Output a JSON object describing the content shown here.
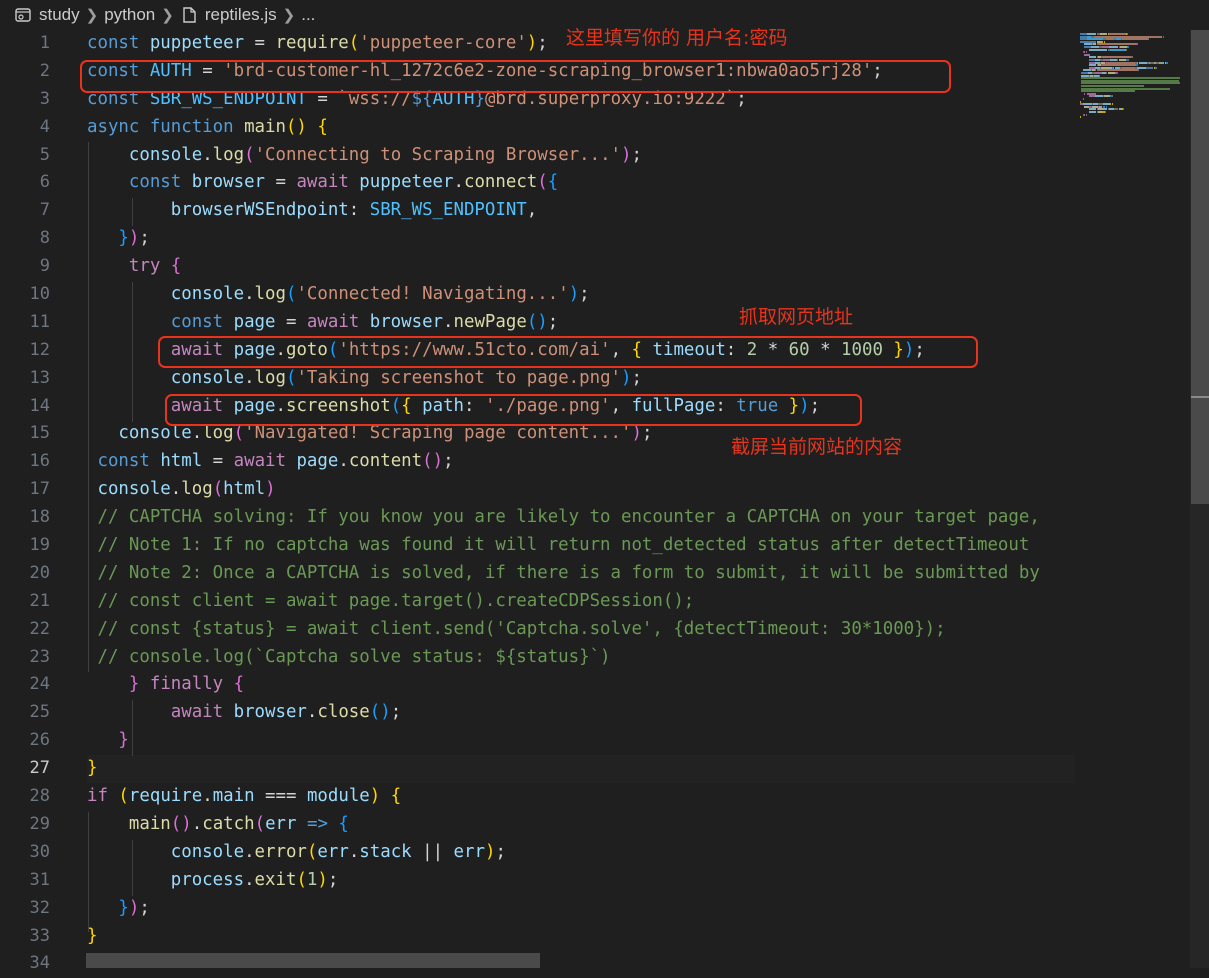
{
  "breadcrumb": {
    "items": [
      "study",
      "python",
      "reptiles.js",
      "..."
    ],
    "icons": [
      "folder-settings-icon",
      "chevron-right-icon",
      "file-icon"
    ]
  },
  "editor": {
    "active_line": 27,
    "line_numbers": [
      "1",
      "2",
      "3",
      "4",
      "5",
      "6",
      "7",
      "8",
      "9",
      "10",
      "11",
      "12",
      "13",
      "14",
      "15",
      "16",
      "17",
      "18",
      "19",
      "20",
      "21",
      "22",
      "23",
      "24",
      "25",
      "26",
      "27",
      "28",
      "29",
      "30",
      "31",
      "32",
      "33",
      "34"
    ],
    "lines": [
      [
        [
          "kw",
          "const "
        ],
        [
          "var",
          "puppeteer"
        ],
        [
          "op",
          " = "
        ],
        [
          "fn",
          "require"
        ],
        [
          "p1",
          "("
        ],
        [
          "str",
          "'puppeteer-core'"
        ],
        [
          "p1",
          ")"
        ],
        [
          "op",
          ";"
        ]
      ],
      [
        [
          "kw",
          "const "
        ],
        [
          "cst",
          "AUTH"
        ],
        [
          "op",
          " = "
        ],
        [
          "str",
          "'brd-customer-hl_1272c6e2-zone-scraping_browser1:nbwa0ao5rj28'"
        ],
        [
          "op",
          ";"
        ]
      ],
      [
        [
          "kw",
          "const "
        ],
        [
          "cst",
          "SBR_WS_ENDPOINT"
        ],
        [
          "op",
          " = "
        ],
        [
          "str",
          "`wss://"
        ],
        [
          "kw",
          "${"
        ],
        [
          "cst",
          "AUTH"
        ],
        [
          "kw",
          "}"
        ],
        [
          "str",
          "@brd.superproxy.io:9222`"
        ],
        [
          "op",
          ";"
        ]
      ],
      [
        [
          "kw",
          "async "
        ],
        [
          "kw",
          "function "
        ],
        [
          "fn",
          "main"
        ],
        [
          "p1",
          "()"
        ],
        [
          "op",
          " "
        ],
        [
          "p1",
          "{"
        ]
      ],
      [
        [
          "op",
          "    "
        ],
        [
          "var",
          "console"
        ],
        [
          "op",
          "."
        ],
        [
          "fn",
          "log"
        ],
        [
          "p2",
          "("
        ],
        [
          "str",
          "'Connecting to Scraping Browser...'"
        ],
        [
          "p2",
          ")"
        ],
        [
          "op",
          ";"
        ]
      ],
      [
        [
          "op",
          "    "
        ],
        [
          "kw",
          "const "
        ],
        [
          "var",
          "browser"
        ],
        [
          "op",
          " = "
        ],
        [
          "kw2",
          "await "
        ],
        [
          "var",
          "puppeteer"
        ],
        [
          "op",
          "."
        ],
        [
          "fn",
          "connect"
        ],
        [
          "p2",
          "("
        ],
        [
          "p3",
          "{"
        ]
      ],
      [
        [
          "op",
          "        "
        ],
        [
          "var",
          "browserWSEndpoint"
        ],
        [
          "op",
          ": "
        ],
        [
          "cst",
          "SBR_WS_ENDPOINT"
        ],
        [
          "op",
          ","
        ]
      ],
      [
        [
          "op",
          "   "
        ],
        [
          "p3",
          "}"
        ],
        [
          "p2",
          ")"
        ],
        [
          "op",
          ";"
        ]
      ],
      [
        [
          "op",
          "    "
        ],
        [
          "kw2",
          "try "
        ],
        [
          "p2",
          "{"
        ]
      ],
      [
        [
          "op",
          "        "
        ],
        [
          "var",
          "console"
        ],
        [
          "op",
          "."
        ],
        [
          "fn",
          "log"
        ],
        [
          "p3",
          "("
        ],
        [
          "str",
          "'Connected! Navigating...'"
        ],
        [
          "p3",
          ")"
        ],
        [
          "op",
          ";"
        ]
      ],
      [
        [
          "op",
          "        "
        ],
        [
          "kw",
          "const "
        ],
        [
          "var",
          "page"
        ],
        [
          "op",
          " = "
        ],
        [
          "kw2",
          "await "
        ],
        [
          "var",
          "browser"
        ],
        [
          "op",
          "."
        ],
        [
          "fn",
          "newPage"
        ],
        [
          "p3",
          "()"
        ],
        [
          "op",
          ";"
        ]
      ],
      [
        [
          "op",
          "        "
        ],
        [
          "kw2",
          "await "
        ],
        [
          "var",
          "page"
        ],
        [
          "op",
          "."
        ],
        [
          "fn",
          "goto"
        ],
        [
          "p3",
          "("
        ],
        [
          "str",
          "'https://www.51cto.com/ai'"
        ],
        [
          "op",
          ", "
        ],
        [
          "p1",
          "{"
        ],
        [
          "op",
          " "
        ],
        [
          "var",
          "timeout"
        ],
        [
          "op",
          ": "
        ],
        [
          "num",
          "2"
        ],
        [
          "op",
          " * "
        ],
        [
          "num",
          "60"
        ],
        [
          "op",
          " * "
        ],
        [
          "num",
          "1000"
        ],
        [
          "op",
          " "
        ],
        [
          "p1",
          "}"
        ],
        [
          "p3",
          ")"
        ],
        [
          "op",
          ";"
        ]
      ],
      [
        [
          "op",
          "        "
        ],
        [
          "var",
          "console"
        ],
        [
          "op",
          "."
        ],
        [
          "fn",
          "log"
        ],
        [
          "p3",
          "("
        ],
        [
          "str",
          "'Taking screenshot to page.png'"
        ],
        [
          "p3",
          ")"
        ],
        [
          "op",
          ";"
        ]
      ],
      [
        [
          "op",
          "        "
        ],
        [
          "kw2",
          "await "
        ],
        [
          "var",
          "page"
        ],
        [
          "op",
          "."
        ],
        [
          "fn",
          "screenshot"
        ],
        [
          "p3",
          "("
        ],
        [
          "p1",
          "{"
        ],
        [
          "op",
          " "
        ],
        [
          "var",
          "path"
        ],
        [
          "op",
          ": "
        ],
        [
          "str",
          "'./page.png'"
        ],
        [
          "op",
          ", "
        ],
        [
          "var",
          "fullPage"
        ],
        [
          "op",
          ": "
        ],
        [
          "kw",
          "true"
        ],
        [
          "op",
          " "
        ],
        [
          "p1",
          "}"
        ],
        [
          "p3",
          ")"
        ],
        [
          "op",
          ";"
        ]
      ],
      [
        [
          "op",
          "   "
        ],
        [
          "var",
          "console"
        ],
        [
          "op",
          "."
        ],
        [
          "fn",
          "log"
        ],
        [
          "p2",
          "("
        ],
        [
          "str",
          "'Navigated! Scraping page content...'"
        ],
        [
          "p2",
          ")"
        ],
        [
          "op",
          ";"
        ]
      ],
      [
        [
          "op",
          " "
        ],
        [
          "kw",
          "const "
        ],
        [
          "var",
          "html"
        ],
        [
          "op",
          " = "
        ],
        [
          "kw2",
          "await "
        ],
        [
          "var",
          "page"
        ],
        [
          "op",
          "."
        ],
        [
          "fn",
          "content"
        ],
        [
          "p2",
          "()"
        ],
        [
          "op",
          ";"
        ]
      ],
      [
        [
          "op",
          " "
        ],
        [
          "var",
          "console"
        ],
        [
          "op",
          "."
        ],
        [
          "fn",
          "log"
        ],
        [
          "p2",
          "("
        ],
        [
          "var",
          "html"
        ],
        [
          "p2",
          ")"
        ]
      ],
      [
        [
          "op",
          " "
        ],
        [
          "cmt",
          "// CAPTCHA solving: If you know you are likely to encounter a CAPTCHA on your target page,"
        ]
      ],
      [
        [
          "op",
          " "
        ],
        [
          "cmt",
          "// Note 1: If no captcha was found it will return not_detected status after detectTimeout"
        ]
      ],
      [
        [
          "op",
          " "
        ],
        [
          "cmt",
          "// Note 2: Once a CAPTCHA is solved, if there is a form to submit, it will be submitted by"
        ]
      ],
      [
        [
          "op",
          " "
        ],
        [
          "cmt",
          "// const client = await page.target().createCDPSession();"
        ]
      ],
      [
        [
          "op",
          " "
        ],
        [
          "cmt",
          "// const {status} = await client.send('Captcha.solve', {detectTimeout: 30*1000});"
        ]
      ],
      [
        [
          "op",
          " "
        ],
        [
          "cmt",
          "// console.log(`Captcha solve status: ${status}`)"
        ]
      ],
      [
        [
          "op",
          "    "
        ],
        [
          "p2",
          "}"
        ],
        [
          "op",
          " "
        ],
        [
          "kw2",
          "finally "
        ],
        [
          "p2",
          "{"
        ]
      ],
      [
        [
          "op",
          "        "
        ],
        [
          "kw2",
          "await "
        ],
        [
          "var",
          "browser"
        ],
        [
          "op",
          "."
        ],
        [
          "fn",
          "close"
        ],
        [
          "p3",
          "()"
        ],
        [
          "op",
          ";"
        ]
      ],
      [
        [
          "op",
          "   "
        ],
        [
          "p2",
          "}"
        ]
      ],
      [
        [
          "p1",
          "}"
        ]
      ],
      [
        [
          "kw2",
          "if "
        ],
        [
          "p1",
          "("
        ],
        [
          "var",
          "require"
        ],
        [
          "op",
          "."
        ],
        [
          "var",
          "main"
        ],
        [
          "op",
          " === "
        ],
        [
          "var",
          "module"
        ],
        [
          "p1",
          ")"
        ],
        [
          "op",
          " "
        ],
        [
          "p1",
          "{"
        ]
      ],
      [
        [
          "op",
          "    "
        ],
        [
          "fn",
          "main"
        ],
        [
          "p2",
          "()"
        ],
        [
          "op",
          "."
        ],
        [
          "fn",
          "catch"
        ],
        [
          "p2",
          "("
        ],
        [
          "var",
          "err"
        ],
        [
          "op",
          " "
        ],
        [
          "kw",
          "=>"
        ],
        [
          "op",
          " "
        ],
        [
          "p3",
          "{"
        ]
      ],
      [
        [
          "op",
          "        "
        ],
        [
          "var",
          "console"
        ],
        [
          "op",
          "."
        ],
        [
          "fn",
          "error"
        ],
        [
          "p1",
          "("
        ],
        [
          "var",
          "err"
        ],
        [
          "op",
          "."
        ],
        [
          "var",
          "stack"
        ],
        [
          "op",
          " || "
        ],
        [
          "var",
          "err"
        ],
        [
          "p1",
          ")"
        ],
        [
          "op",
          ";"
        ]
      ],
      [
        [
          "op",
          "        "
        ],
        [
          "var",
          "process"
        ],
        [
          "op",
          "."
        ],
        [
          "fn",
          "exit"
        ],
        [
          "p1",
          "("
        ],
        [
          "num",
          "1"
        ],
        [
          "p1",
          ")"
        ],
        [
          "op",
          ";"
        ]
      ],
      [
        [
          "op",
          "   "
        ],
        [
          "p3",
          "}"
        ],
        [
          "p2",
          ")"
        ],
        [
          "op",
          ";"
        ]
      ],
      [
        [
          "p1",
          "}"
        ]
      ],
      [
        [
          "op",
          ""
        ]
      ]
    ]
  },
  "annotations": {
    "auth": "这里填写你的 用户名:密码",
    "url": "抓取网页地址",
    "screenshot": "截屏当前网站的内容"
  },
  "colors": {
    "background": "#1f1f1f",
    "highlight": "#e8341c",
    "keyword": "#569cd6",
    "control": "#c586c0",
    "variable": "#9cdcfe",
    "constant": "#4fc1ff",
    "function": "#dcdcaa",
    "string": "#ce9178",
    "number": "#b5cea8",
    "comment": "#6a9955"
  }
}
